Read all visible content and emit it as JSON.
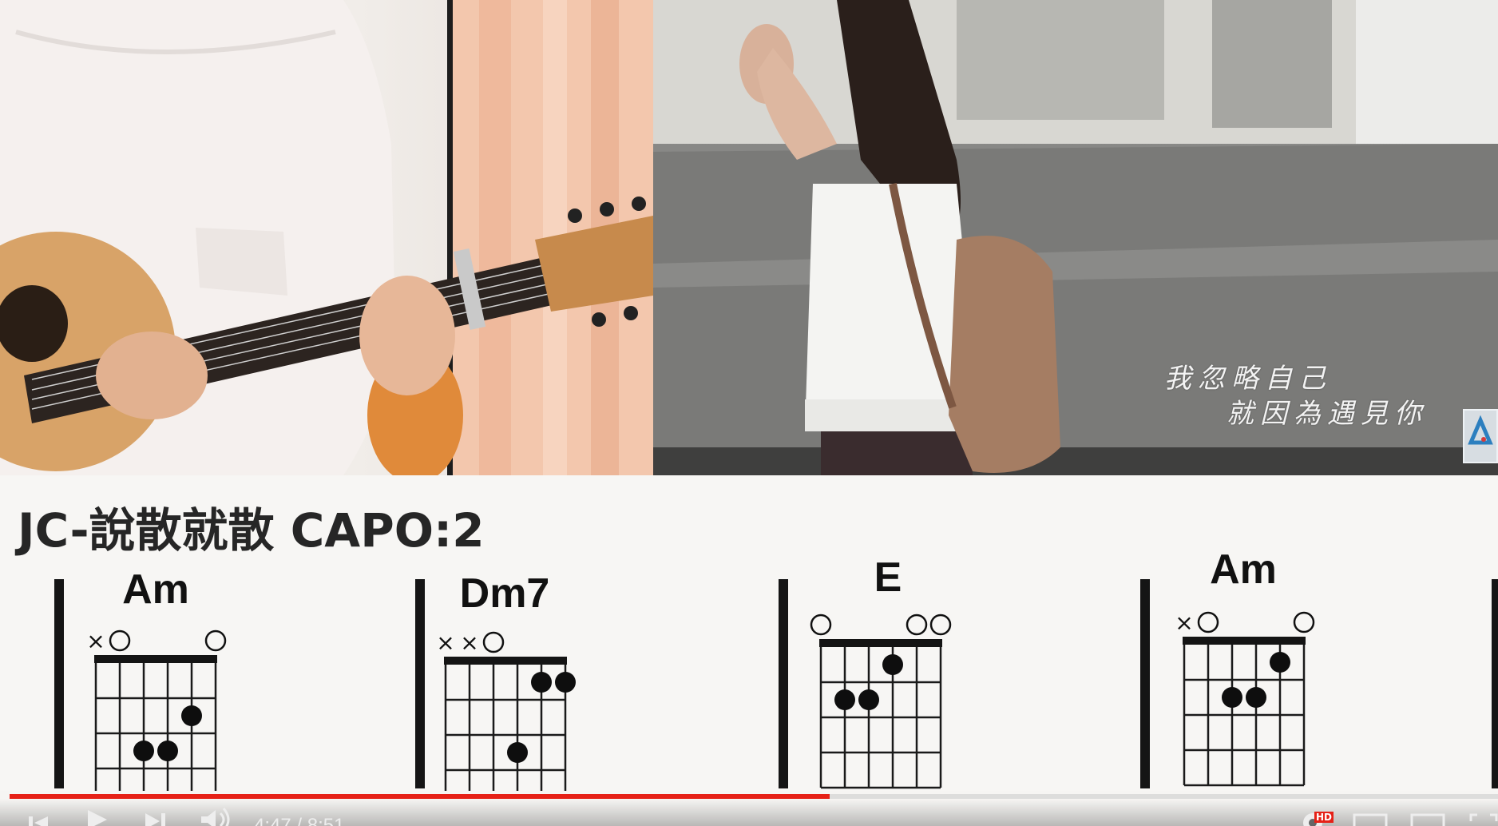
{
  "video": {
    "lyrics": [
      "我忽略自己",
      "就因為遇見你"
    ]
  },
  "chord_sheet": {
    "title": "JC-說散就散 CAPO:2",
    "chords": [
      {
        "name": "Am",
        "mute": [
          1
        ],
        "open": [
          2,
          6
        ],
        "dots": [
          [
            2,
            5
          ],
          [
            3,
            4
          ],
          [
            3,
            3
          ]
        ]
      },
      {
        "name": "Dm7",
        "mute": [
          1,
          2
        ],
        "open": [
          3
        ],
        "dots": [
          [
            1,
            5
          ],
          [
            1,
            6
          ],
          [
            3,
            4
          ]
        ]
      },
      {
        "name": "E",
        "mute": [],
        "open": [
          1,
          5,
          6
        ],
        "dots": [
          [
            1,
            4
          ],
          [
            2,
            3
          ],
          [
            2,
            2
          ]
        ]
      },
      {
        "name": "Am",
        "mute": [
          1
        ],
        "open": [
          2,
          6
        ],
        "dots": [
          [
            1,
            5
          ],
          [
            2,
            4
          ],
          [
            2,
            3
          ]
        ]
      }
    ]
  },
  "player": {
    "current_time": "4:47",
    "separator": "/",
    "duration": "8:51",
    "progress": 0.551,
    "accent_color": "#e62117",
    "hd_label": "HD",
    "icons": [
      "previous-icon",
      "play-icon",
      "next-icon",
      "volume-icon",
      "settings-icon",
      "miniplayer-icon",
      "theater-icon",
      "fullscreen-icon"
    ]
  }
}
